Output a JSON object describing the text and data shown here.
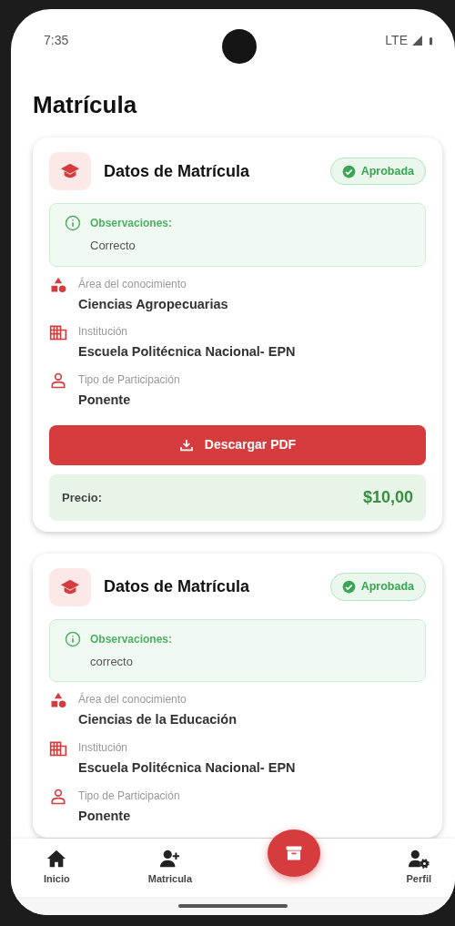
{
  "status_bar": {
    "time": "7:35",
    "network": "LTE"
  },
  "page_title": "Matrícula",
  "cards": [
    {
      "title": "Datos de Matrícula",
      "status": "Aprobada",
      "observations": {
        "label": "Observaciones:",
        "text": "Correcto"
      },
      "details": [
        {
          "label": "Área del conocimiento",
          "value": "Ciencias Agropecuarias"
        },
        {
          "label": "Institución",
          "value": "Escuela Politécnica Nacional- EPN"
        },
        {
          "label": "Tipo de Participación",
          "value": "Ponente"
        }
      ],
      "download_button": "Descargar PDF",
      "price": {
        "label": "Precio:",
        "value": "$10,00"
      }
    },
    {
      "title": "Datos de Matrícula",
      "status": "Aprobada",
      "observations": {
        "label": "Observaciones:",
        "text": "correcto"
      },
      "details": [
        {
          "label": "Área del conocimiento",
          "value": "Ciencias de la Educación"
        },
        {
          "label": "Institución",
          "value": "Escuela Politécnica Nacional- EPN"
        },
        {
          "label": "Tipo de Participación",
          "value": "Ponente"
        }
      ]
    }
  ],
  "bottom_nav": [
    {
      "label": "Inicio"
    },
    {
      "label": "Matricula"
    },
    {
      "label": "Perfil"
    }
  ]
}
